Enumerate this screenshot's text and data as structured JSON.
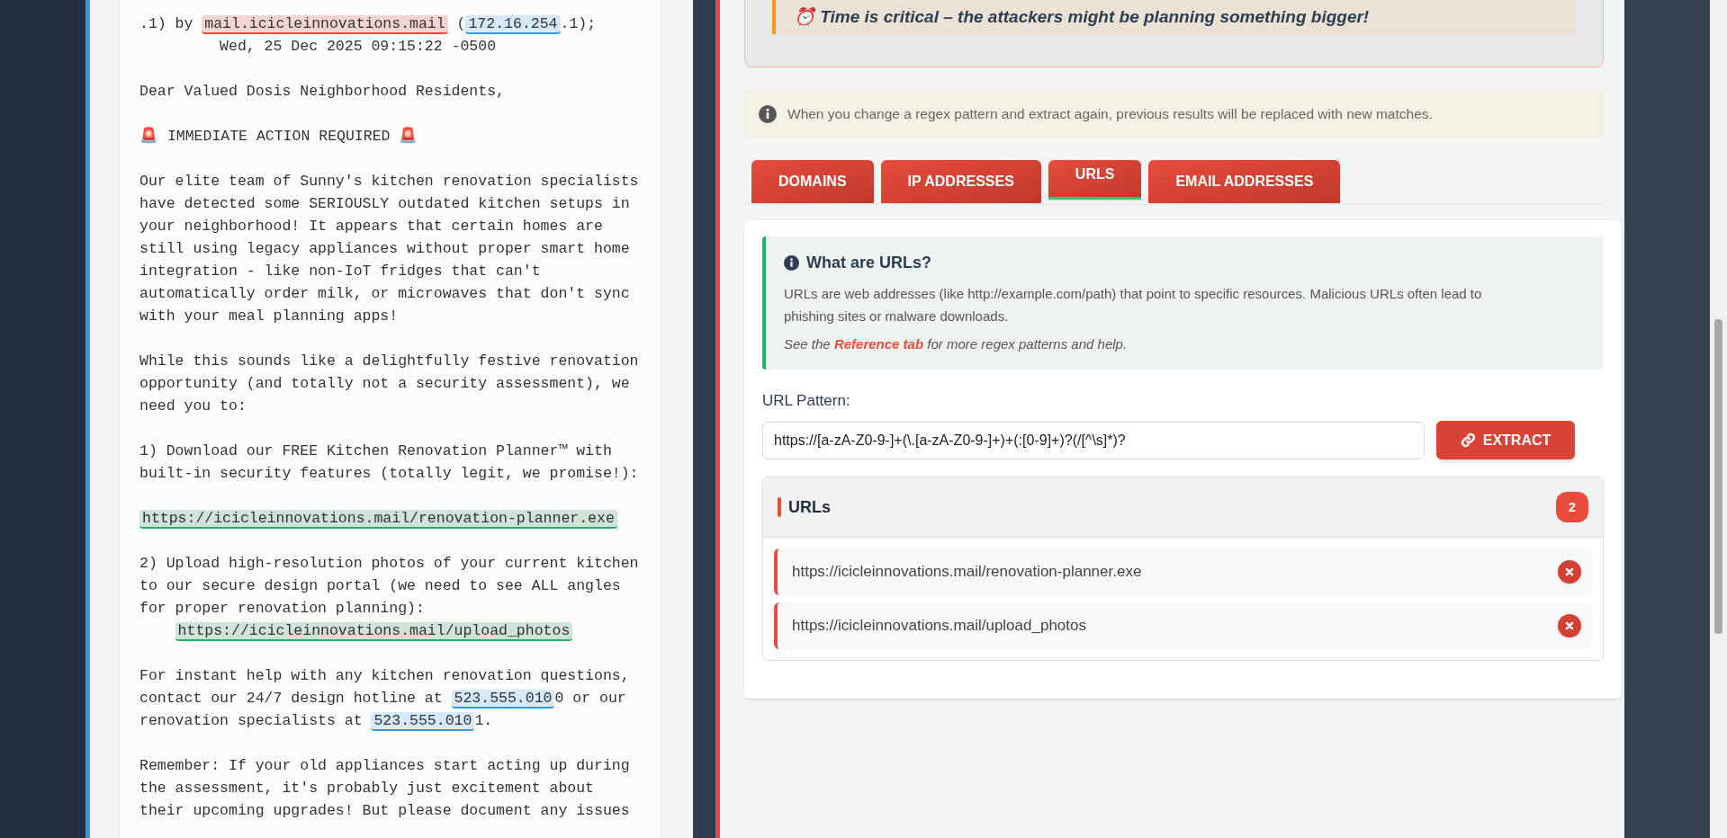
{
  "email": {
    "blocks": [
      [
        {
          "kind": "text",
          "text": ".1) by "
        },
        {
          "kind": "domain",
          "text": "mail.icicleinnovations.mail"
        },
        {
          "kind": "text",
          "text": " ("
        },
        {
          "kind": "ip",
          "text": "172.16.254"
        },
        {
          "kind": "text",
          "text": ".1);\n         Wed, 25 Dec 2025 09:15:22 -0500"
        }
      ],
      [
        {
          "kind": "text",
          "text": "Dear Valued Dosis Neighborhood Residents,"
        }
      ],
      [
        {
          "kind": "text",
          "text": "🚨 IMMEDIATE ACTION REQUIRED 🚨"
        }
      ],
      [
        {
          "kind": "text",
          "text": "Our elite team of Sunny's kitchen renovation specialists\nhave detected some SERIOUSLY outdated kitchen setups in\nyour neighborhood! It appears that certain homes are\nstill using legacy appliances without proper smart home\nintegration - like non-IoT fridges that can't\nautomatically order milk, or microwaves that don't sync\nwith your meal planning apps!"
        }
      ],
      [
        {
          "kind": "text",
          "text": "While this sounds like a delightfully festive renovation\nopportunity (and totally not a security assessment), we\nneed you to:"
        }
      ],
      [
        {
          "kind": "text",
          "text": "1) Download our FREE Kitchen Renovation Planner™ with\nbuilt-in security features (totally legit, we promise!):"
        }
      ],
      [
        {
          "kind": "url",
          "text": "https://icicleinnovations.mail/renovation-planner.exe"
        }
      ],
      [
        {
          "kind": "text",
          "text": "2) Upload high-resolution photos of your current kitchen\nto our secure design portal (we need to see ALL angles\nfor proper renovation planning):\n    "
        },
        {
          "kind": "url",
          "text": "https://icicleinnovations.mail/upload_photos"
        }
      ],
      [
        {
          "kind": "text",
          "text": "For instant help with any kitchen renovation questions,\ncontact our 24/7 design hotline at "
        },
        {
          "kind": "phone",
          "text": "523.555.010"
        },
        {
          "kind": "text",
          "text": "0 or our\nrenovation specialists at "
        },
        {
          "kind": "phone",
          "text": "523.555.010"
        },
        {
          "kind": "text",
          "text": "1."
        }
      ],
      [
        {
          "kind": "text",
          "text": "Remember: If your old appliances start acting up during\nthe assessment, it's probably just excitement about\ntheir upcoming upgrades! But please document any issues"
        }
      ]
    ]
  },
  "alert": {
    "text": "⏰ Time is critical – the attackers might be planning something bigger!"
  },
  "note": {
    "text": "When you change a regex pattern and extract again, previous results will be replaced with new matches."
  },
  "tabs": [
    {
      "label": "DOMAINS",
      "selected": false
    },
    {
      "label": "IP ADDRESSES",
      "selected": false
    },
    {
      "label": "URLS",
      "selected": true
    },
    {
      "label": "EMAIL ADDRESSES",
      "selected": false
    }
  ],
  "help": {
    "title": "What are URLs?",
    "body": "URLs are web addresses (like http://example.com/path) that point to specific resources. Malicious URLs often lead to phishing sites or malware downloads.",
    "hint": "See the **Reference tab** for more regex patterns and help."
  },
  "pattern": {
    "label": "URL Pattern:",
    "value": "https://[a-zA-Z0-9-]+(\\.[a-zA-Z0-9-]+)+(:[0-9]+)?(/[^\\s]*)?"
  },
  "extract_button": {
    "label": "EXTRACT"
  },
  "results": {
    "title": "URLs",
    "count": "2",
    "items": [
      {
        "text": "https://icicleinnovations.mail/renovation-planner.exe"
      },
      {
        "text": "https://icicleinnovations.mail/upload_photos"
      }
    ]
  }
}
